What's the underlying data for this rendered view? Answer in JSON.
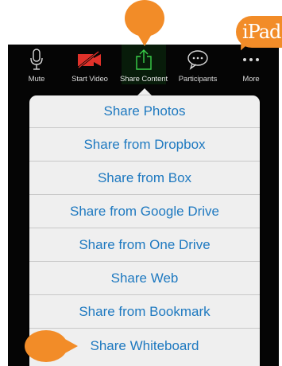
{
  "toolbar": {
    "buttons": [
      {
        "label": "Mute",
        "icon": "microphone-icon"
      },
      {
        "label": "Start Video",
        "icon": "video-off-icon"
      },
      {
        "label": "Share Content",
        "icon": "share-icon",
        "active": true
      },
      {
        "label": "Participants",
        "icon": "chat-bubble-icon"
      },
      {
        "label": "More",
        "icon": "more-icon"
      }
    ]
  },
  "share_menu": {
    "items": [
      "Share Photos",
      "Share from Dropbox",
      "Share from Box",
      "Share from Google Drive",
      "Share from One Drive",
      "Share Web",
      "Share from Bookmark",
      "Share Whiteboard"
    ]
  },
  "badge": {
    "text": "iPad"
  },
  "colors": {
    "accent": "#f28c28",
    "link": "#1e79c0",
    "share_active": "#3ad14a",
    "video_off": "#e0312a",
    "toolbar_bg": "#050505",
    "menu_bg": "#efefef"
  }
}
